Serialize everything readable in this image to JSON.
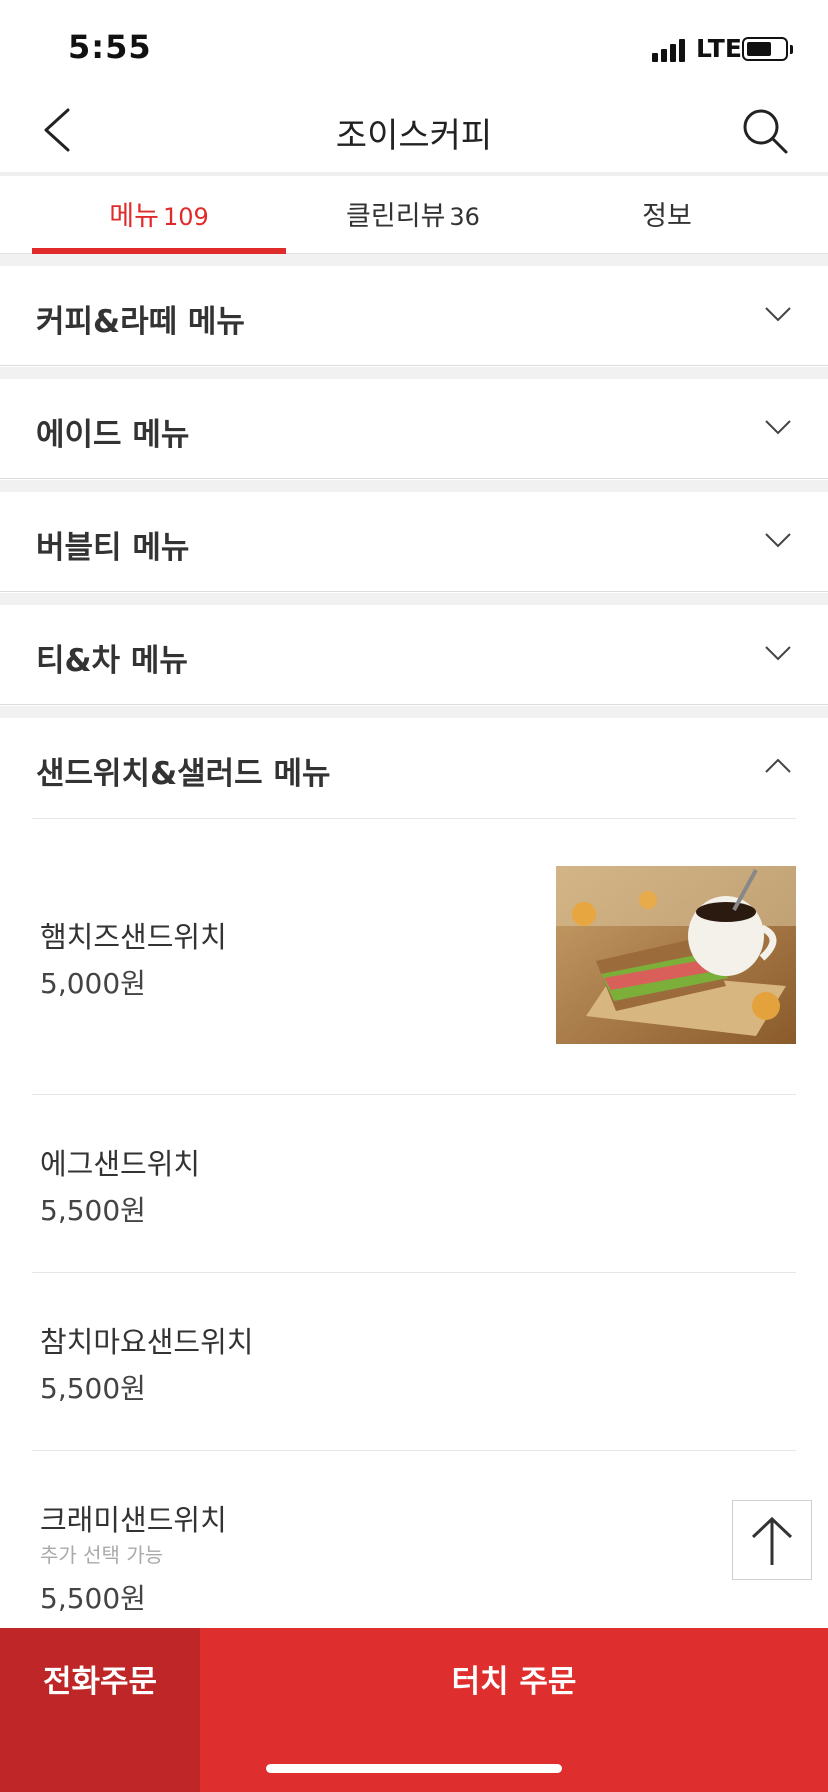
{
  "status_bar": {
    "time": "5:55",
    "network": "LTE"
  },
  "nav": {
    "title": "조이스커피",
    "back_icon": "chevron-left-icon",
    "search_icon": "search-icon"
  },
  "tabs": [
    {
      "label": "메뉴",
      "count": "109",
      "active": true
    },
    {
      "label": "클린리뷰",
      "count": "36",
      "active": false
    },
    {
      "label": "정보",
      "count": "",
      "active": false
    }
  ],
  "sections": [
    {
      "label": "커피&라떼 메뉴",
      "expanded": false
    },
    {
      "label": "에이드 메뉴",
      "expanded": false
    },
    {
      "label": "버블티 메뉴",
      "expanded": false
    },
    {
      "label": "티&차 메뉴",
      "expanded": false
    },
    {
      "label": "샌드위치&샐러드 메뉴",
      "expanded": true
    }
  ],
  "items": [
    {
      "name": "햄치즈샌드위치",
      "price": "5,000원",
      "note": "",
      "has_photo": true
    },
    {
      "name": "에그샌드위치",
      "price": "5,500원",
      "note": ""
    },
    {
      "name": "참치마요샌드위치",
      "price": "5,500원",
      "note": ""
    },
    {
      "name": "크래미샌드위치",
      "price": "5,500원",
      "note": "추가 선택 가능"
    }
  ],
  "bottom": {
    "phone_order": "전화주문",
    "touch_order": "터치 주문"
  },
  "colors": {
    "accent": "#df2e2e",
    "accent_dark": "#be2627"
  }
}
